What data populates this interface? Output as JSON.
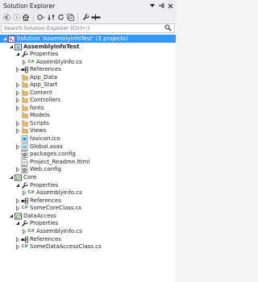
{
  "window": {
    "title": "Solution Explorer"
  },
  "search": {
    "placeholder": "Search Solution Explorer (Ctrl+;)"
  },
  "tree": {
    "rows": [
      {
        "label": "Solution 'AssemblyInfoTest' (3 projects)",
        "icon": "solution-icon",
        "expander": "expanded",
        "selected": true
      },
      {
        "label": "AssemblyInfoTest",
        "icon": "web-project-icon",
        "expander": "expanded",
        "bold": true
      },
      {
        "label": "Properties",
        "icon": "wrench-icon",
        "expander": "expanded"
      },
      {
        "label": "AssemblyInfo.cs",
        "icon": "csharp-file-icon",
        "expander": "collapsed"
      },
      {
        "label": "References",
        "icon": "references-icon",
        "expander": "collapsed"
      },
      {
        "label": "App_Data",
        "icon": "folder-icon"
      },
      {
        "label": "App_Start",
        "icon": "folder-icon",
        "expander": "collapsed"
      },
      {
        "label": "Content",
        "icon": "folder-icon",
        "expander": "collapsed"
      },
      {
        "label": "Controllers",
        "icon": "folder-icon",
        "expander": "collapsed"
      },
      {
        "label": "fonts",
        "icon": "folder-icon",
        "expander": "collapsed"
      },
      {
        "label": "Models",
        "icon": "folder-icon"
      },
      {
        "label": "Scripts",
        "icon": "folder-icon",
        "expander": "collapsed"
      },
      {
        "label": "Views",
        "icon": "folder-icon",
        "expander": "collapsed"
      },
      {
        "label": "favicon.ico",
        "icon": "image-file-icon"
      },
      {
        "label": "Global.asax",
        "icon": "asax-file-icon",
        "expander": "collapsed"
      },
      {
        "label": "packages.config",
        "icon": "config-file-icon"
      },
      {
        "label": "Project_Readme.html",
        "icon": "html-file-icon"
      },
      {
        "label": "Web.config",
        "icon": "config-file-icon",
        "expander": "collapsed"
      },
      {
        "label": "Core",
        "icon": "library-project-icon",
        "expander": "expanded"
      },
      {
        "label": "Properties",
        "icon": "wrench-icon",
        "expander": "expanded"
      },
      {
        "label": "AssemblyInfo.cs",
        "icon": "csharp-file-icon",
        "expander": "collapsed"
      },
      {
        "label": "References",
        "icon": "references-icon",
        "expander": "collapsed"
      },
      {
        "label": "SomeCoreClass.cs",
        "icon": "csharp-file-icon",
        "expander": "collapsed"
      },
      {
        "label": "DataAccess",
        "icon": "library-project-icon",
        "expander": "expanded"
      },
      {
        "label": "Properties",
        "icon": "wrench-icon",
        "expander": "expanded"
      },
      {
        "label": "AssemblyInfo.cs",
        "icon": "csharp-file-icon",
        "expander": "collapsed"
      },
      {
        "label": "References",
        "icon": "references-icon",
        "expander": "collapsed"
      },
      {
        "label": "SomeDataAccessClass.cs",
        "icon": "csharp-file-icon",
        "expander": "collapsed"
      }
    ]
  }
}
